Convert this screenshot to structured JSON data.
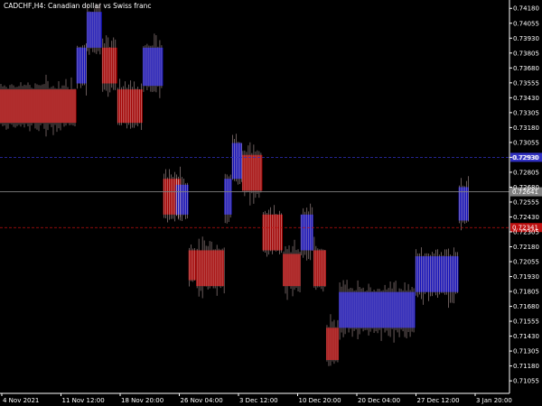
{
  "window": {
    "title": "CADCHF,H4:  Canadian dollar vs Swiss franc"
  },
  "colors": {
    "background": "#000000",
    "bull": "#1010b8",
    "bear": "#a00000",
    "wick": "#e8c8c8",
    "axis": "#ffffff",
    "level_blue": "#3030c0",
    "level_gray": "#808080",
    "level_red": "#c01010"
  },
  "chart_data": {
    "type": "candlestick-renko",
    "symbol": "CADCHF",
    "timeframe": "H4",
    "ylim": [
      0.7095,
      0.7425
    ],
    "y_ticks": [
      "0.74180",
      "0.74055",
      "0.73930",
      "0.73805",
      "0.73680",
      "0.73555",
      "0.73430",
      "0.73305",
      "0.73180",
      "0.73055",
      "0.72930",
      "0.72805",
      "0.72680",
      "0.72555",
      "0.72430",
      "0.72305",
      "0.72180",
      "0.72055",
      "0.71930",
      "0.71805",
      "0.71680",
      "0.71555",
      "0.71430",
      "0.71305",
      "0.71180",
      "0.71055"
    ],
    "x_ticks": [
      "4 Nov 2021",
      "11 Nov 12:00",
      "18 Nov 20:00",
      "26 Nov 04:00",
      "3 Dec 12:00",
      "10 Dec 20:00",
      "20 Dec 04:00",
      "27 Dec 12:00",
      "3 Jan 20:00"
    ],
    "boxes": [
      {
        "x0": 0,
        "x1": 0.15,
        "y0": 0.735,
        "y1": 0.7322,
        "dir": "down"
      },
      {
        "x0": 0.15,
        "x1": 0.17,
        "y0": 0.7355,
        "y1": 0.7385,
        "dir": "up"
      },
      {
        "x0": 0.17,
        "x1": 0.2,
        "y0": 0.7385,
        "y1": 0.7415,
        "dir": "up"
      },
      {
        "x0": 0.2,
        "x1": 0.23,
        "y0": 0.7385,
        "y1": 0.7355,
        "dir": "down"
      },
      {
        "x0": 0.23,
        "x1": 0.28,
        "y0": 0.735,
        "y1": 0.7322,
        "dir": "down"
      },
      {
        "x0": 0.28,
        "x1": 0.32,
        "y0": 0.7353,
        "y1": 0.7385,
        "dir": "up"
      },
      {
        "x0": 0.32,
        "x1": 0.355,
        "y0": 0.7275,
        "y1": 0.7245,
        "dir": "down"
      },
      {
        "x0": 0.345,
        "x1": 0.37,
        "y0": 0.7245,
        "y1": 0.727,
        "dir": "up"
      },
      {
        "x0": 0.37,
        "x1": 0.385,
        "y0": 0.7215,
        "y1": 0.719,
        "dir": "down"
      },
      {
        "x0": 0.385,
        "x1": 0.44,
        "y0": 0.7215,
        "y1": 0.7185,
        "dir": "down"
      },
      {
        "x0": 0.44,
        "x1": 0.455,
        "y0": 0.7245,
        "y1": 0.7275,
        "dir": "up"
      },
      {
        "x0": 0.455,
        "x1": 0.475,
        "y0": 0.7275,
        "y1": 0.7305,
        "dir": "up"
      },
      {
        "x0": 0.475,
        "x1": 0.515,
        "y0": 0.7295,
        "y1": 0.7265,
        "dir": "down"
      },
      {
        "x0": 0.515,
        "x1": 0.555,
        "y0": 0.7245,
        "y1": 0.7215,
        "dir": "down"
      },
      {
        "x0": 0.555,
        "x1": 0.59,
        "y0": 0.7212,
        "y1": 0.7185,
        "dir": "down"
      },
      {
        "x0": 0.59,
        "x1": 0.615,
        "y0": 0.7215,
        "y1": 0.7245,
        "dir": "up"
      },
      {
        "x0": 0.615,
        "x1": 0.64,
        "y0": 0.7215,
        "y1": 0.7185,
        "dir": "down"
      },
      {
        "x0": 0.64,
        "x1": 0.665,
        "y0": 0.715,
        "y1": 0.7123,
        "dir": "down"
      },
      {
        "x0": 0.665,
        "x1": 0.815,
        "y0": 0.715,
        "y1": 0.718,
        "dir": "up"
      },
      {
        "x0": 0.815,
        "x1": 0.9,
        "y0": 0.718,
        "y1": 0.721,
        "dir": "up"
      },
      {
        "x0": 0.9,
        "x1": 0.92,
        "y0": 0.724,
        "y1": 0.7268,
        "dir": "up"
      }
    ],
    "levels": [
      {
        "price": 0.7293,
        "label": "0.72930",
        "color": "level_blue",
        "style": "dashed"
      },
      {
        "price": 0.72641,
        "label": "0.72641",
        "color": "level_gray",
        "style": "solid"
      },
      {
        "price": 0.72341,
        "label": "0.72341",
        "color": "level_red",
        "style": "dashed"
      }
    ]
  }
}
